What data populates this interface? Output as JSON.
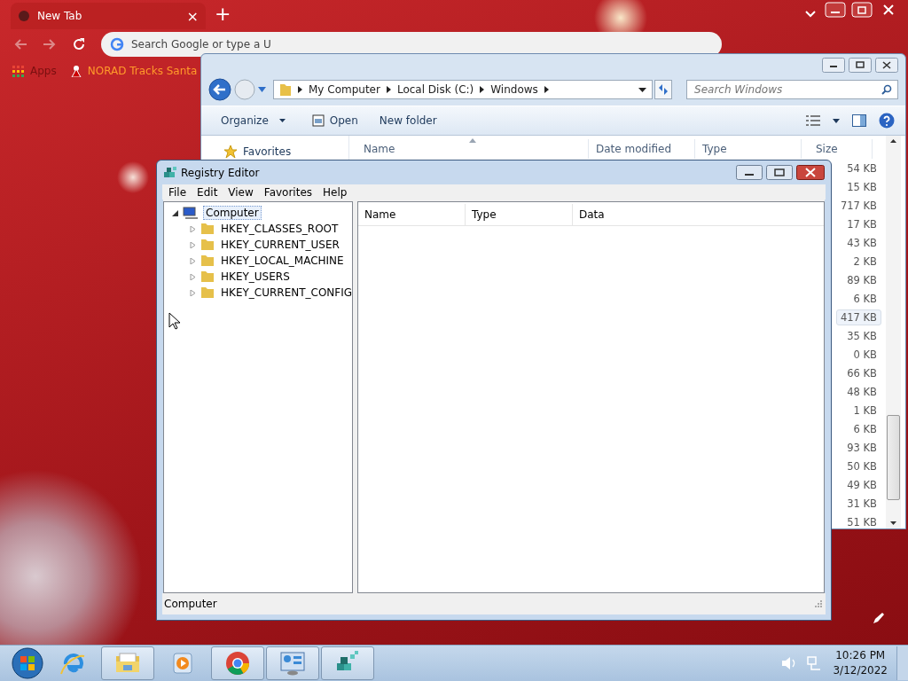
{
  "browser": {
    "tab": {
      "title": "New Tab",
      "close": "×"
    },
    "new_tab": "+",
    "omnibox": {
      "placeholder": "Search Google or type a U"
    },
    "bookmarks": [
      {
        "label": "Apps",
        "kind": "apps"
      },
      {
        "label": "NORAD Tracks Santa",
        "kind": "site"
      }
    ]
  },
  "explorer": {
    "breadcrumb": [
      "My Computer",
      "Local Disk (C:)",
      "Windows"
    ],
    "search": {
      "placeholder": "Search Windows"
    },
    "toolbar": [
      {
        "label": "Organize",
        "kind": "menu"
      },
      {
        "label": "Open",
        "kind": "icon"
      },
      {
        "label": "New folder",
        "kind": "plain"
      }
    ],
    "nav": [
      {
        "label": "Favorites"
      }
    ],
    "columns": [
      "Name",
      "Date modified",
      "Type",
      "Size"
    ],
    "sizes": [
      {
        "text": "54 KB",
        "selected": false
      },
      {
        "text": "15 KB",
        "selected": false
      },
      {
        "text": "717 KB",
        "selected": false
      },
      {
        "text": "17 KB",
        "selected": false
      },
      {
        "text": "43 KB",
        "selected": false
      },
      {
        "text": "2 KB",
        "selected": false
      },
      {
        "text": "89 KB",
        "selected": false
      },
      {
        "text": "6 KB",
        "selected": false
      },
      {
        "text": "417 KB",
        "selected": true
      },
      {
        "text": "35 KB",
        "selected": false
      },
      {
        "text": "0 KB",
        "selected": false
      },
      {
        "text": "66 KB",
        "selected": false
      },
      {
        "text": "48 KB",
        "selected": false
      },
      {
        "text": "1 KB",
        "selected": false
      },
      {
        "text": "6 KB",
        "selected": false
      },
      {
        "text": "93 KB",
        "selected": false
      },
      {
        "text": "50 KB",
        "selected": false
      },
      {
        "text": "49 KB",
        "selected": false
      },
      {
        "text": "31 KB",
        "selected": false
      },
      {
        "text": "51 KB",
        "selected": false
      }
    ]
  },
  "regedit": {
    "title": "Registry Editor",
    "menu": [
      "File",
      "Edit",
      "View",
      "Favorites",
      "Help"
    ],
    "tree": {
      "label": "Computer",
      "expanded": true,
      "selected": true,
      "children": [
        {
          "label": "HKEY_CLASSES_ROOT",
          "expanded": false
        },
        {
          "label": "HKEY_CURRENT_USER",
          "expanded": false
        },
        {
          "label": "HKEY_LOCAL_MACHINE",
          "expanded": false
        },
        {
          "label": "HKEY_USERS",
          "expanded": false
        },
        {
          "label": "HKEY_CURRENT_CONFIG",
          "expanded": false
        }
      ]
    },
    "columns": [
      "Name",
      "Type",
      "Data"
    ],
    "status": "Computer"
  },
  "taskbar": {
    "apps": [
      {
        "kind": "ie",
        "open": false
      },
      {
        "kind": "explorer",
        "open": true
      },
      {
        "kind": "media",
        "open": false
      },
      {
        "kind": "chrome",
        "open": true
      },
      {
        "kind": "control",
        "open": true
      },
      {
        "kind": "regedit",
        "open": true
      }
    ],
    "time": "10:26 PM",
    "date": "3/12/2022"
  }
}
